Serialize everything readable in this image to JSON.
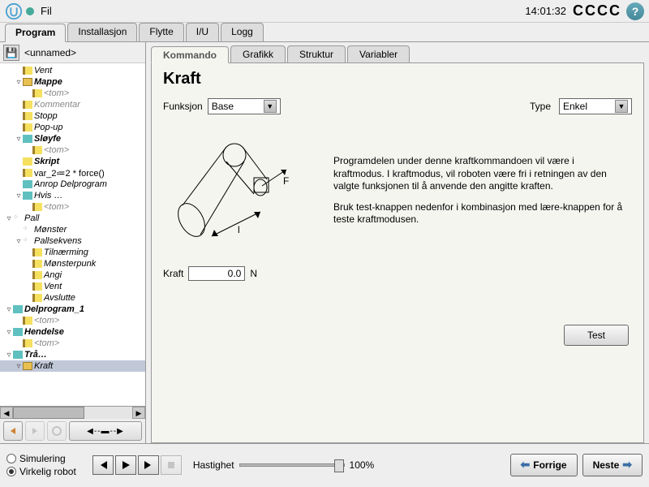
{
  "titlebar": {
    "fil": "Fil",
    "time": "14:01:32",
    "cccc": "CCCC"
  },
  "maintabs": [
    "Program",
    "Installasjon",
    "Flytte",
    "I/U",
    "Logg"
  ],
  "maintabs_active": 0,
  "left_header": {
    "name": "<unnamed>"
  },
  "tree": [
    {
      "indent": 1,
      "exp": "",
      "icon": "y",
      "label": "Vent",
      "cls": "italic"
    },
    {
      "indent": 1,
      "exp": "▿",
      "icon": "folder",
      "label": "Mappe",
      "cls": "bold"
    },
    {
      "indent": 2,
      "exp": "",
      "icon": "y",
      "label": "<tom>",
      "cls": "gray"
    },
    {
      "indent": 1,
      "exp": "",
      "icon": "y",
      "label": "Kommentar",
      "cls": "gray"
    },
    {
      "indent": 1,
      "exp": "",
      "icon": "y",
      "label": "Stopp",
      "cls": "italic"
    },
    {
      "indent": 1,
      "exp": "",
      "icon": "y",
      "label": "Pop-up",
      "cls": "italic"
    },
    {
      "indent": 1,
      "exp": "▿",
      "icon": "cyan",
      "label": "Sløyfe",
      "cls": "bold"
    },
    {
      "indent": 2,
      "exp": "",
      "icon": "y",
      "label": "<tom>",
      "cls": "gray"
    },
    {
      "indent": 1,
      "exp": "",
      "icon": "cmd",
      "label": "Skript",
      "cls": "bold"
    },
    {
      "indent": 1,
      "exp": "",
      "icon": "y",
      "label": "var_2≔2 * force()",
      "cls": ""
    },
    {
      "indent": 1,
      "exp": "",
      "icon": "cyan",
      "label": "Anrop Delprogram",
      "cls": "italic"
    },
    {
      "indent": 1,
      "exp": "▿",
      "icon": "cyan",
      "label": "Hvis …",
      "cls": "italic"
    },
    {
      "indent": 2,
      "exp": "",
      "icon": "y",
      "label": "<tom>",
      "cls": "gray"
    },
    {
      "indent": 0,
      "exp": "▿",
      "icon": "dots",
      "label": "Pall",
      "cls": "italic"
    },
    {
      "indent": 1,
      "exp": "",
      "icon": "dots",
      "label": "Mønster",
      "cls": "italic"
    },
    {
      "indent": 1,
      "exp": "▿",
      "icon": "dots",
      "label": "Pallsekvens",
      "cls": "italic"
    },
    {
      "indent": 2,
      "exp": "",
      "icon": "y",
      "label": "Tilnærming",
      "cls": "italic"
    },
    {
      "indent": 2,
      "exp": "",
      "icon": "y",
      "label": "Mønsterpunk",
      "cls": "italic"
    },
    {
      "indent": 2,
      "exp": "",
      "icon": "y",
      "label": "Angi",
      "cls": "italic"
    },
    {
      "indent": 2,
      "exp": "",
      "icon": "y",
      "label": "Vent",
      "cls": "italic"
    },
    {
      "indent": 2,
      "exp": "",
      "icon": "y",
      "label": "Avslutte",
      "cls": "italic"
    },
    {
      "indent": 0,
      "exp": "▿",
      "icon": "cyan",
      "label": "Delprogram_1",
      "cls": "bold"
    },
    {
      "indent": 1,
      "exp": "",
      "icon": "y",
      "label": "<tom>",
      "cls": "gray"
    },
    {
      "indent": 0,
      "exp": "▿",
      "icon": "cyan",
      "label": "Hendelse",
      "cls": "bold"
    },
    {
      "indent": 1,
      "exp": "",
      "icon": "y",
      "label": "<tom>",
      "cls": "gray"
    },
    {
      "indent": 0,
      "exp": "▿",
      "icon": "cyan",
      "label": "Trå…",
      "cls": "bold"
    },
    {
      "indent": 1,
      "exp": "▿",
      "icon": "folder",
      "label": "Kraft",
      "cls": "italic",
      "sel": true
    }
  ],
  "subtabs": [
    "Kommando",
    "Grafikk",
    "Struktur",
    "Variabler"
  ],
  "subtabs_active": 0,
  "panel": {
    "title": "Kraft",
    "funksjon_label": "Funksjon",
    "funksjon_value": "Base",
    "type_label": "Type",
    "type_value": "Enkel",
    "kraft_label": "Kraft",
    "kraft_value": "0.0",
    "kraft_unit": "N",
    "desc1": "Programdelen under denne kraftkommandoen vil være i kraftmodus. I kraftmodus, vil roboten være fri i retningen av den valgte funksjonen til å anvende den angitte kraften.",
    "desc2": "Bruk test-knappen nedenfor i kombinasjon med lære-knappen for å teste kraftmodusen.",
    "test": "Test"
  },
  "footer": {
    "sim": "Simulering",
    "real": "Virkelig robot",
    "speed_label": "Hastighet",
    "speed_value": "100%",
    "prev": "Forrige",
    "next": "Neste"
  }
}
